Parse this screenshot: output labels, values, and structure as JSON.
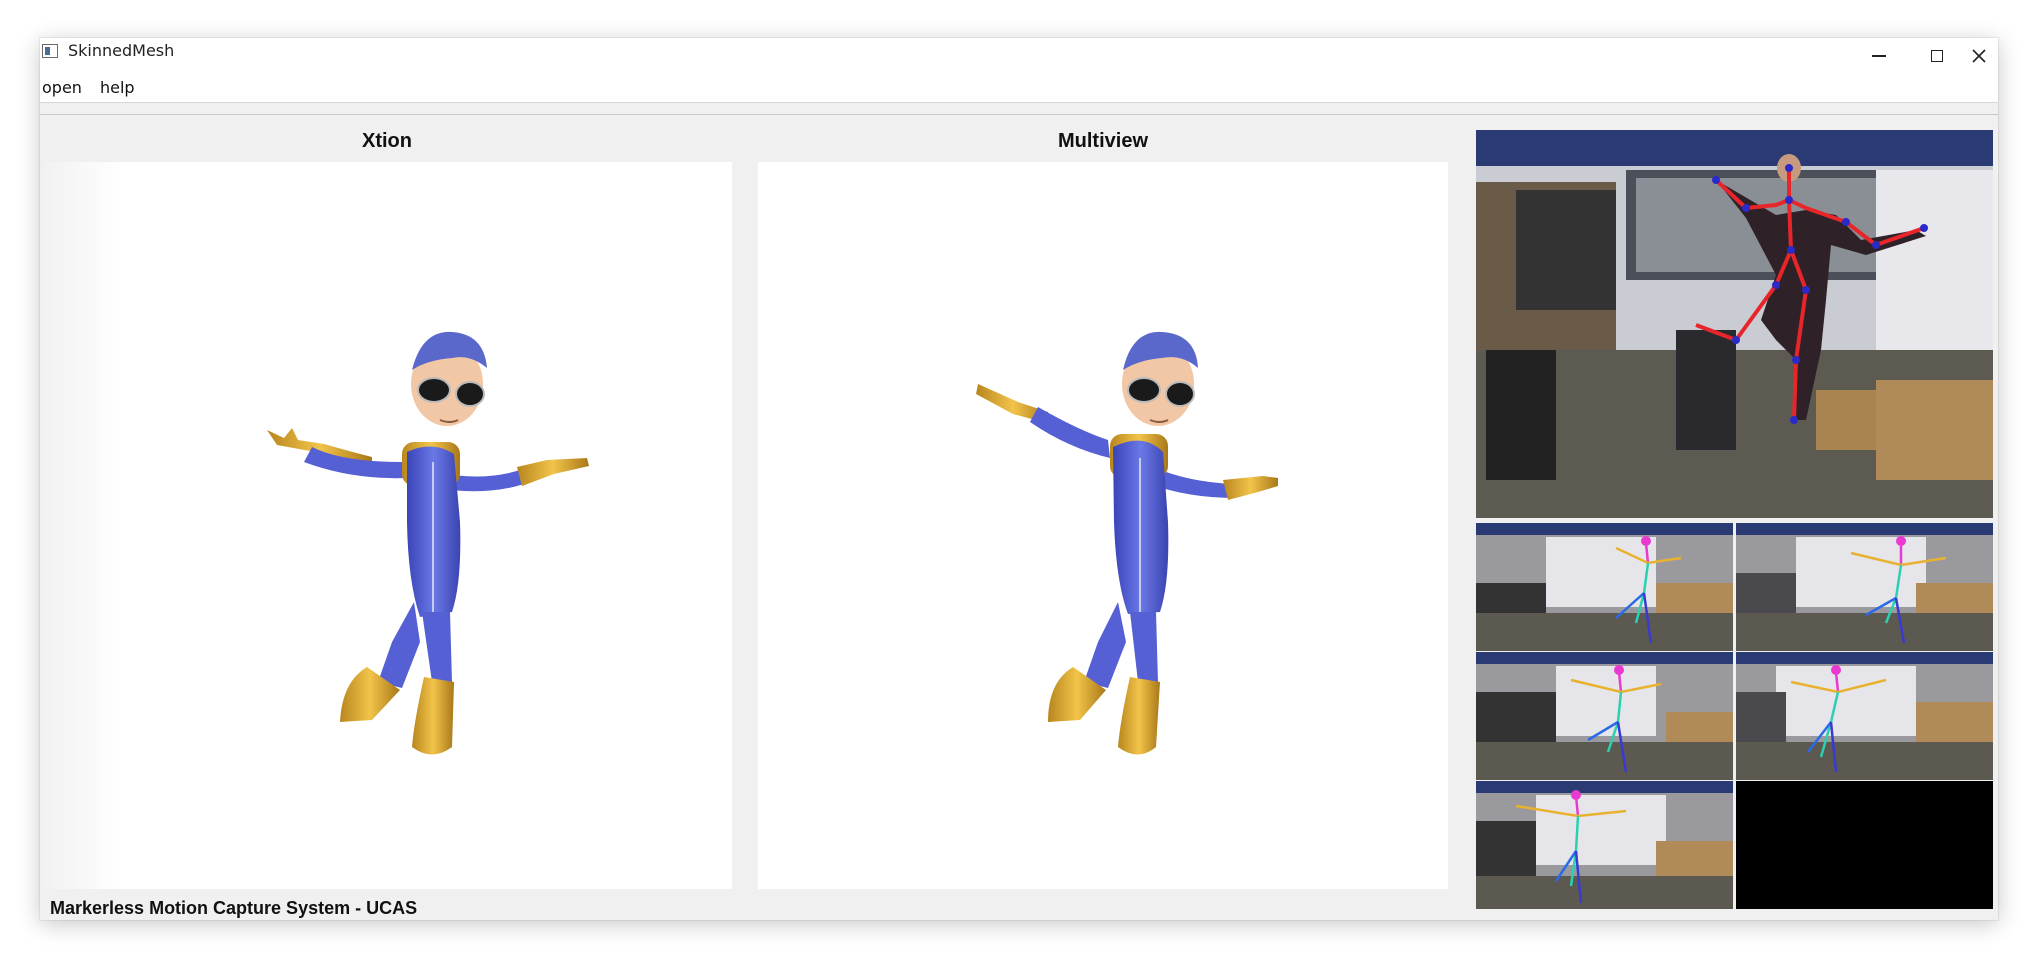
{
  "window": {
    "title": "SkinnedMesh",
    "icon": "app-window-icon",
    "controls": [
      "minimize-icon",
      "maximize-icon",
      "close-icon"
    ]
  },
  "menu": {
    "items": [
      {
        "label": "open"
      },
      {
        "label": "help"
      }
    ]
  },
  "panels": {
    "left_title": "Xtion",
    "middle_title": "Multiview"
  },
  "status": {
    "text": "Markerless Motion Capture System - UCAS"
  },
  "camera_views": {
    "main": "xtion-camera-feed",
    "grid": [
      "camera-view-1",
      "camera-view-2",
      "camera-view-3",
      "camera-view-4",
      "camera-view-5",
      "empty-view"
    ]
  },
  "colors": {
    "skeleton_main": "#e8262a",
    "joint": "#2a2ac8",
    "suit": "#5a68d8",
    "gold": "#e8b43a"
  }
}
